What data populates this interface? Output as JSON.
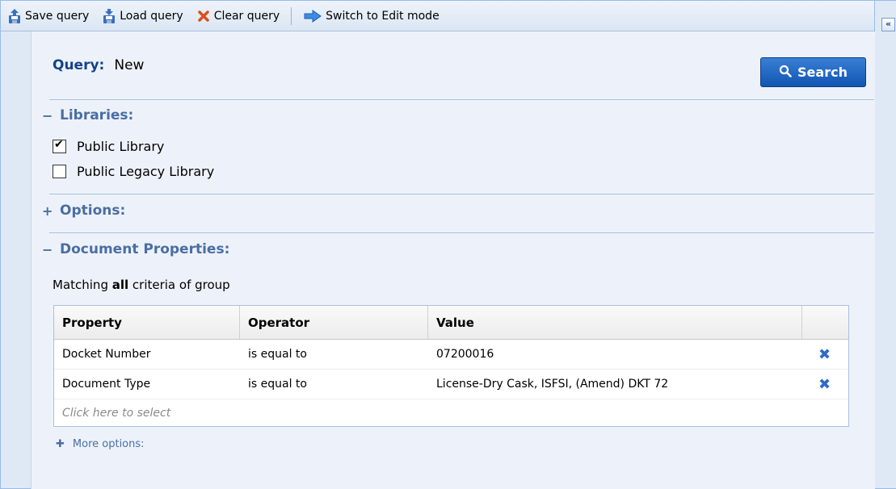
{
  "toolbar": {
    "save_label": "Save query",
    "load_label": "Load query",
    "clear_label": "Clear query",
    "switch_label": "Switch to Edit mode",
    "collapse_glyph": "«"
  },
  "query": {
    "label": "Query:",
    "value": "New",
    "search_label": "Search"
  },
  "libraries": {
    "toggle": "−",
    "title": "Libraries:",
    "items": [
      {
        "label": "Public Library",
        "checked": true
      },
      {
        "label": "Public Legacy Library",
        "checked": false
      }
    ]
  },
  "options": {
    "toggle": "+",
    "title": "Options:"
  },
  "document_properties": {
    "toggle": "−",
    "title": "Document Properties:",
    "matching_prefix": "Matching ",
    "matching_bold": "all",
    "matching_suffix": " criteria of group",
    "columns": [
      "Property",
      "Operator",
      "Value",
      ""
    ],
    "rows": [
      {
        "property": "Docket Number",
        "operator": "is equal to",
        "value": "07200016"
      },
      {
        "property": "Document Type",
        "operator": "is equal to",
        "value": "License-Dry Cask, ISFSI, (Amend) DKT 72"
      }
    ],
    "placeholder": "Click here to select",
    "more_options": "More options:"
  },
  "colors": {
    "accent": "#15428b",
    "section": "#4a6ea3",
    "search_button": "#1056b3",
    "delete_icon": "#2e6cc8"
  }
}
